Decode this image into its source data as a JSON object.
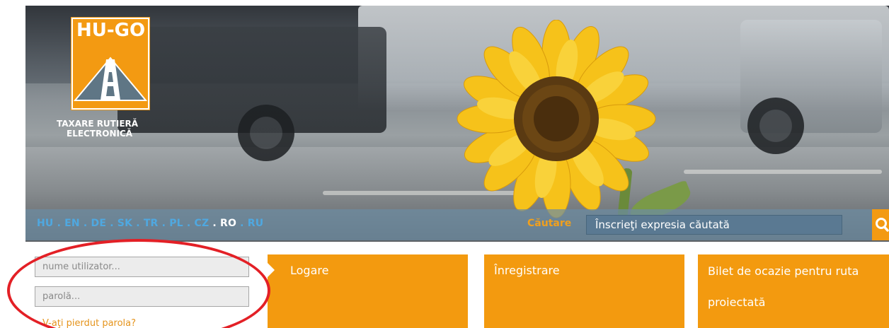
{
  "logo": {
    "badge_text": "HU-GO",
    "tagline_line1": "TAXARE RUTIERĂ",
    "tagline_line2": "ELECTRONICĂ"
  },
  "languages": [
    {
      "code": "HU",
      "active": false
    },
    {
      "code": "EN",
      "active": false
    },
    {
      "code": "DE",
      "active": false
    },
    {
      "code": "SK",
      "active": false
    },
    {
      "code": "TR",
      "active": false
    },
    {
      "code": "PL",
      "active": false
    },
    {
      "code": "CZ",
      "active": false
    },
    {
      "code": "RO",
      "active": true
    },
    {
      "code": "RU",
      "active": false
    }
  ],
  "search": {
    "label": "Căutare",
    "placeholder": "Înscrieţi expresia căutată",
    "icon": "search-icon"
  },
  "login": {
    "username_placeholder": "nume utilizator...",
    "password_placeholder": "parolă...",
    "forgot_link": "V-aţi pierdut parola?"
  },
  "tiles": {
    "login_label": "Logare",
    "register_label": "Înregistrare",
    "ticket_label": "Bilet de ocazie pentru ruta proiectată"
  },
  "colors": {
    "brand_orange": "#f39a12",
    "link_blue": "#4fa8e0",
    "annotation_red": "#e32026",
    "logo_slate": "#5f7685"
  }
}
